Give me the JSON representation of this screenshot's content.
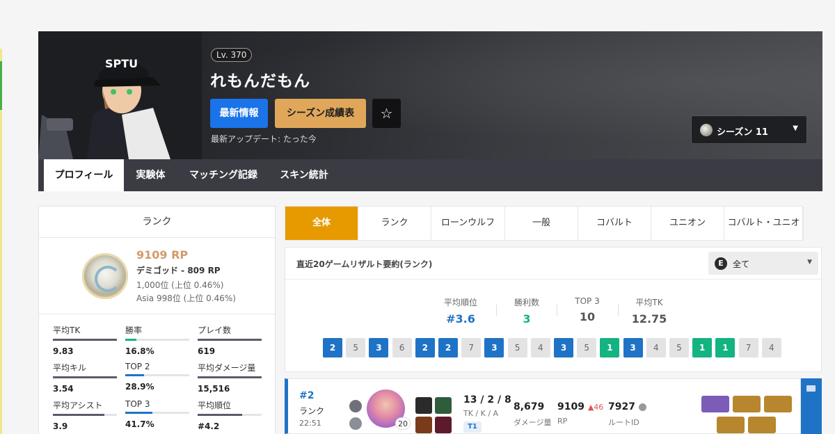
{
  "header": {
    "level": "Lv. 370",
    "username": "れもんだもん",
    "update_button": "最新情報",
    "season_record_button": "シーズン成績表",
    "favorite_icon": "star-icon",
    "last_updated": "最新アップデート: たった今",
    "season_select": "シーズン 11"
  },
  "nav": {
    "tabs": [
      "プロフィール",
      "実験体",
      "マッチング記録",
      "スキン統計"
    ]
  },
  "rank_card": {
    "title": "ランク",
    "rp": "9109 RP",
    "tier": "デミゴッド - 809 RP",
    "global_rank": "1,000位 (上位 0.46%)",
    "region_rank": "Asia 998位 (上位 0.46%)",
    "stats": [
      {
        "label": "平均TK",
        "value": "9.83",
        "fill": 1.0,
        "color": "#5a5c6b"
      },
      {
        "label": "勝率",
        "value": "16.8%",
        "fill": 0.17,
        "color": "#14b382"
      },
      {
        "label": "プレイ数",
        "value": "619",
        "fill": 1.0,
        "color": "#5a5c6b"
      },
      {
        "label": "平均キル",
        "value": "3.54",
        "fill": 1.0,
        "color": "#5a5c6b"
      },
      {
        "label": "TOP 2",
        "value": "28.9%",
        "fill": 0.29,
        "color": "#1f73c6"
      },
      {
        "label": "平均ダメージ量",
        "value": "15,516",
        "fill": 1.0,
        "color": "#5a5c6b"
      },
      {
        "label": "平均アシスト",
        "value": "3.9",
        "fill": 0.8,
        "color": "#5a5c6b"
      },
      {
        "label": "TOP 3",
        "value": "41.7%",
        "fill": 0.42,
        "color": "#1f73c6"
      },
      {
        "label": "平均順位",
        "value": "#4.2",
        "fill": 0.7,
        "color": "#5a5c6b"
      }
    ]
  },
  "filter_tabs": [
    "全体",
    "ランク",
    "ローンウルフ",
    "一般",
    "コバルト",
    "ユニオン",
    "コバルト・ユニオン"
  ],
  "summary": {
    "title": "直近20ゲームリザルト要約(ランク)",
    "mode_select": "全て",
    "mode_icon_letter": "E",
    "stats": [
      {
        "label": "平均順位",
        "value": "#3.6",
        "color": "#1f73c6"
      },
      {
        "label": "勝利数",
        "value": "3",
        "color": "#14b382"
      },
      {
        "label": "TOP 3",
        "value": "10",
        "color": "#555555"
      },
      {
        "label": "平均TK",
        "value": "12.75",
        "color": "#555555"
      }
    ],
    "places": [
      {
        "n": "2",
        "c": "blue"
      },
      {
        "n": "5",
        "c": "gray"
      },
      {
        "n": "3",
        "c": "blue"
      },
      {
        "n": "6",
        "c": "gray"
      },
      {
        "n": "2",
        "c": "blue"
      },
      {
        "n": "2",
        "c": "blue"
      },
      {
        "n": "7",
        "c": "gray"
      },
      {
        "n": "3",
        "c": "blue"
      },
      {
        "n": "5",
        "c": "gray"
      },
      {
        "n": "4",
        "c": "gray"
      },
      {
        "n": "3",
        "c": "blue"
      },
      {
        "n": "5",
        "c": "gray"
      },
      {
        "n": "1",
        "c": "green"
      },
      {
        "n": "3",
        "c": "blue"
      },
      {
        "n": "4",
        "c": "gray"
      },
      {
        "n": "5",
        "c": "gray"
      },
      {
        "n": "1",
        "c": "green"
      },
      {
        "n": "1",
        "c": "green"
      },
      {
        "n": "7",
        "c": "gray"
      },
      {
        "n": "4",
        "c": "gray"
      }
    ]
  },
  "match": {
    "place": "#2",
    "mode": "ランク",
    "time": "22:51",
    "char_level": "20",
    "kda": "13 / 2 / 8",
    "kda_label": "TK / K / A",
    "tier_badge": "T1",
    "damage": "8,679",
    "damage_label": "ダメージ量",
    "rp": "9109",
    "rp_change": "▲46",
    "rp_label": "RP",
    "route_id": "7927",
    "route_label": "ルートID",
    "skill_icons": [
      "trait-icon-1",
      "trait-icon-2",
      "tactical-icon",
      "augment-icon"
    ],
    "items": [
      {
        "name": "weapon-item-icon",
        "color": "#7d5bb8"
      },
      {
        "name": "chest-item-icon",
        "color": "#b8862e"
      },
      {
        "name": "head-item-icon",
        "color": "#b8862e"
      },
      {
        "name": "arm-item-icon",
        "color": "#b8862e"
      },
      {
        "name": "leg-item-icon",
        "color": "#b8862e"
      }
    ]
  }
}
